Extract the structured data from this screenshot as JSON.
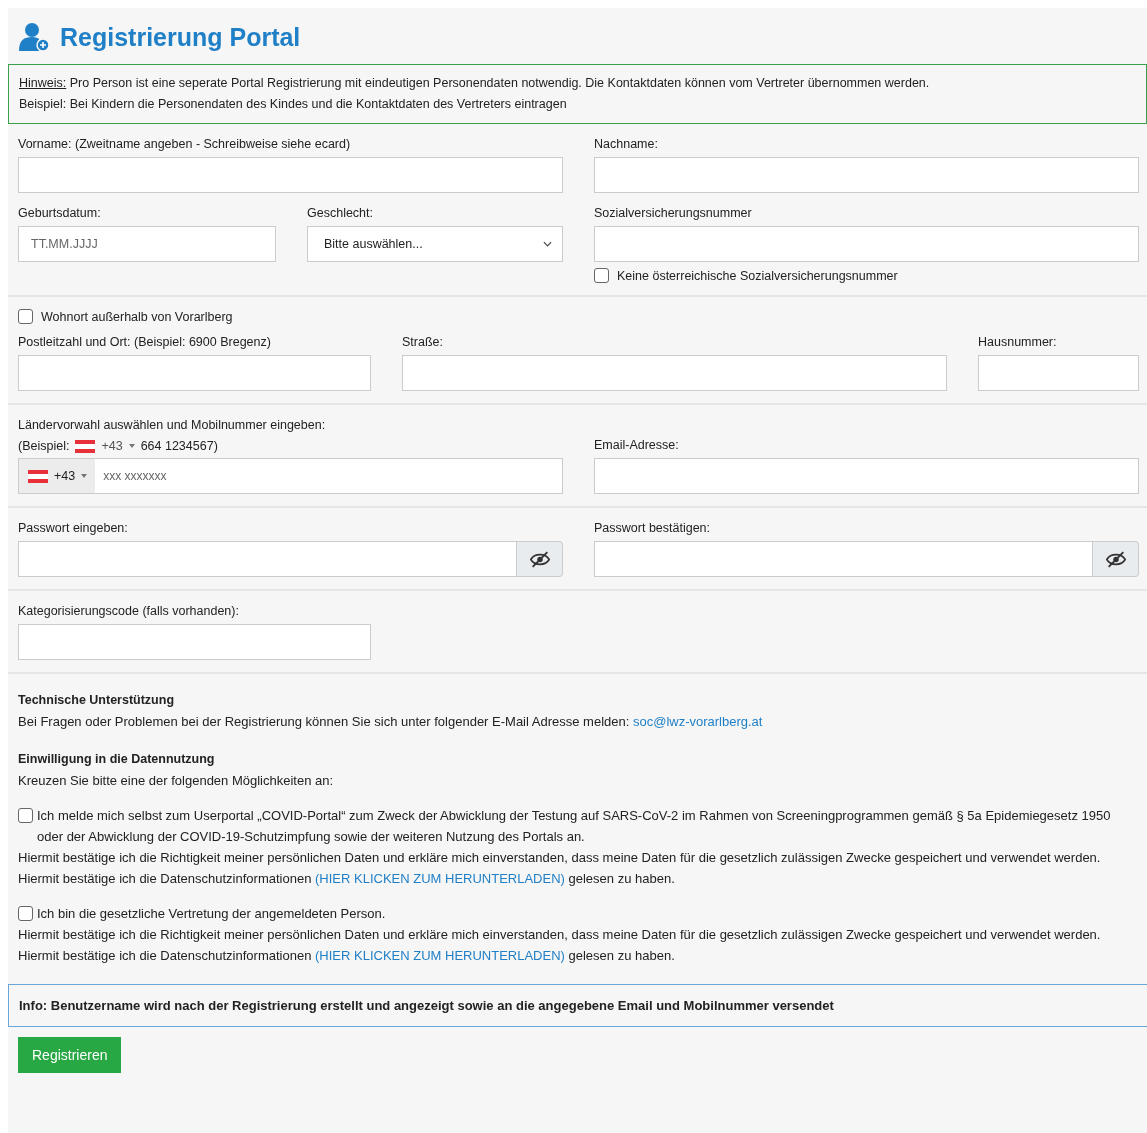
{
  "title": "Registrierung Portal",
  "notice": {
    "label": "Hinweis:",
    "text": "Pro Person ist eine seperate Portal Registrierung mit eindeutigen Personendaten notwendig. Die Kontaktdaten können vom Vertreter übernommen werden.",
    "example": "Beispiel: Bei Kindern die Personendaten des Kindes und die Kontaktdaten des Vertreters eintragen"
  },
  "personal": {
    "first_name": {
      "label": "Vorname: (Zweitname angeben - Schreibweise siehe ecard)"
    },
    "last_name": {
      "label": "Nachname:"
    },
    "birth_date": {
      "label": "Geburtsdatum:",
      "placeholder": "TT.MM.JJJJ"
    },
    "gender": {
      "label": "Geschlecht:",
      "value": "Bitte auswählen..."
    },
    "ssn": {
      "label": "Sozialversicherungsnummer"
    },
    "no_ssn": {
      "label": "Keine österreichische Sozialversicherungsnummer",
      "checked": false
    }
  },
  "address": {
    "outside": {
      "label": "Wohnort außerhalb von Vorarlberg",
      "checked": false
    },
    "postal": {
      "label": "Postleitzahl und Ort: (Beispiel: 6900 Bregenz)"
    },
    "street": {
      "label": "Straße:"
    },
    "house": {
      "label": "Hausnummer:"
    }
  },
  "contact": {
    "phone_label": "Ländervorwahl auswählen und Mobilnummer eingeben:",
    "example_prefix": "(Beispiel:",
    "example_code": "+43",
    "example_number": "664 1234567)",
    "phone_code": "+43",
    "phone_placeholder": "xxx xxxxxxx",
    "email_label": "Email-Adresse:"
  },
  "password": {
    "label": "Passwort eingeben:",
    "confirm_label": "Passwort bestätigen:"
  },
  "category": {
    "label": "Kategorisierungscode (falls vorhanden):"
  },
  "support": {
    "heading": "Technische Unterstützung",
    "text": "Bei Fragen oder Problemen bei der Registrierung können Sie sich unter folgender E-Mail Adresse melden:",
    "email": "soc@lwz-vorarlberg.at"
  },
  "consent": {
    "heading": "Einwilligung in die Datennutzung",
    "text": "Kreuzen Sie bitte eine der folgenden Möglichkeiten an:",
    "options": [
      {
        "checked": false,
        "label": "Ich melde mich selbst zum Userportal „COVID-Portal“ zum Zweck der Abwicklung der Testung auf SARS-CoV-2 im Rahmen von Screeningprogrammen gemäß § 5a Epidemiegesetz 1950 oder der Abwicklung der COVID-19-Schutzimpfung sowie der weiteren Nutzung des Portals an.",
        "confirm": "Hiermit bestätige ich die Richtigkeit meiner persönlichen Daten und erkläre mich einverstanden, dass meine Daten für die gesetzlich zulässigen Zwecke gespeichert und verwendet werden.",
        "privacy_before": "Hiermit bestätige ich die Datenschutzinformationen",
        "privacy_link": "(HIER KLICKEN ZUM HERUNTERLADEN)",
        "privacy_after": "gelesen zu haben."
      },
      {
        "checked": false,
        "label": "Ich bin die gesetzliche Vertretung der angemeldeten Person.",
        "confirm": "Hiermit bestätige ich die Richtigkeit meiner persönlichen Daten und erkläre mich einverstanden, dass meine Daten für die gesetzlich zulässigen Zwecke gespeichert und verwendet werden.",
        "privacy_before": "Hiermit bestätige ich die Datenschutzinformationen",
        "privacy_link": "(HIER KLICKEN ZUM HERUNTERLADEN)",
        "privacy_after": "gelesen zu haben."
      }
    ]
  },
  "info": "Info: Benutzername wird nach der Registrierung erstellt und angezeigt sowie an die angegebene Email und Mobilnummer versendet",
  "submit": "Registrieren"
}
